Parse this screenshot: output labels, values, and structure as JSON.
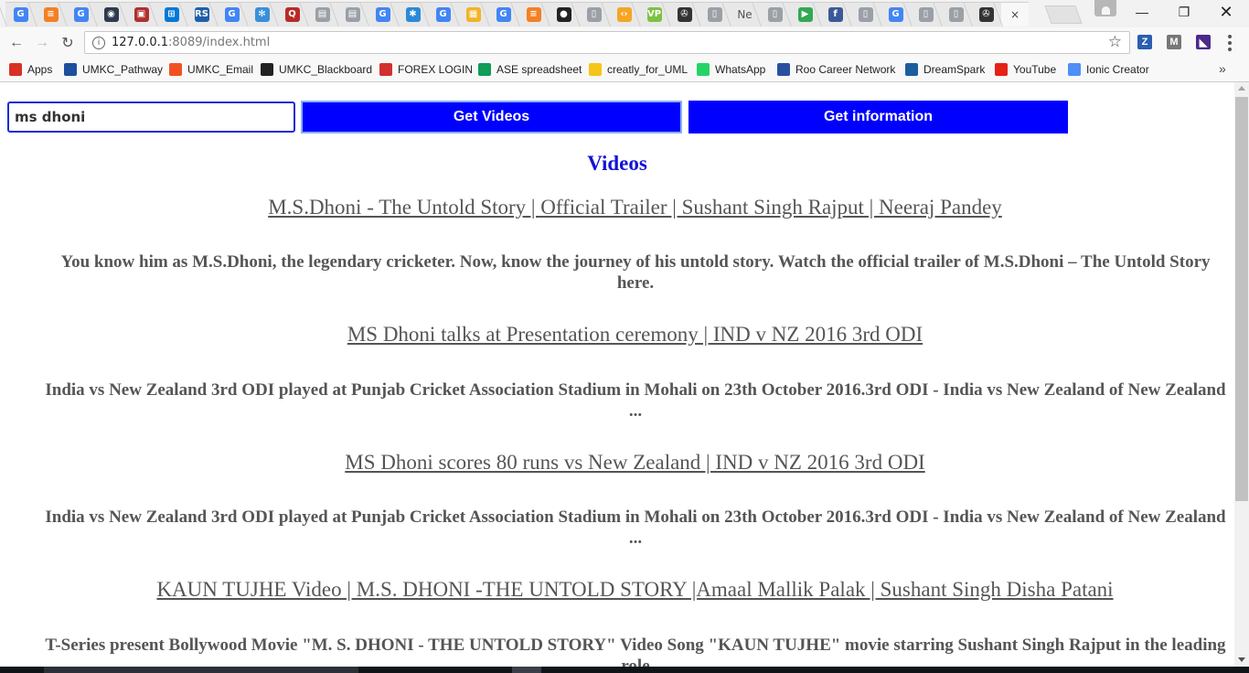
{
  "browser": {
    "tabs": [
      {
        "icon": "google-icon",
        "glyph": "G",
        "color": "#4285f4"
      },
      {
        "icon": "stackoverflow-icon",
        "glyph": "≡",
        "color": "#f48024"
      },
      {
        "icon": "google-icon",
        "glyph": "G",
        "color": "#4285f4"
      },
      {
        "icon": "camera-icon",
        "glyph": "◉",
        "color": "#2d3b4e"
      },
      {
        "icon": "media-icon",
        "glyph": "▣",
        "color": "#b03030"
      },
      {
        "icon": "windows-icon",
        "glyph": "⊞",
        "color": "#0078d7"
      },
      {
        "icon": "rs-icon",
        "glyph": "RS",
        "color": "#1f5fa8"
      },
      {
        "icon": "google-icon",
        "glyph": "G",
        "color": "#4285f4"
      },
      {
        "icon": "snowflake-icon",
        "glyph": "✻",
        "color": "#3a8fd8"
      },
      {
        "icon": "quora-icon",
        "glyph": "Q",
        "color": "#b92b27"
      },
      {
        "icon": "doc-icon",
        "glyph": "▤",
        "color": "#9aa0a6"
      },
      {
        "icon": "doc-icon",
        "glyph": "▤",
        "color": "#9aa0a6"
      },
      {
        "icon": "google-icon",
        "glyph": "G",
        "color": "#4285f4"
      },
      {
        "icon": "asterisk-icon",
        "glyph": "✱",
        "color": "#2a8ad8"
      },
      {
        "icon": "google-icon",
        "glyph": "G",
        "color": "#4285f4"
      },
      {
        "icon": "box-icon",
        "glyph": "▦",
        "color": "#f0b429"
      },
      {
        "icon": "google-icon",
        "glyph": "G",
        "color": "#4285f4"
      },
      {
        "icon": "stackoverflow-icon",
        "glyph": "≡",
        "color": "#f48024"
      },
      {
        "icon": "github-icon",
        "glyph": "●",
        "color": "#222222"
      },
      {
        "icon": "page-icon",
        "glyph": "▯",
        "color": "#9aa0a6"
      },
      {
        "icon": "code-icon",
        "glyph": "‹›",
        "color": "#f5a623"
      },
      {
        "icon": "vp-icon",
        "glyph": "VP",
        "color": "#7dc242"
      },
      {
        "icon": "film-icon",
        "glyph": "✇",
        "color": "#333333"
      },
      {
        "icon": "page-icon",
        "glyph": "▯",
        "color": "#9aa0a6"
      },
      {
        "icon": "ne-tab-text",
        "glyph": "Ne",
        "color": "#555555",
        "text": true
      },
      {
        "icon": "page-icon",
        "glyph": "▯",
        "color": "#9aa0a6"
      },
      {
        "icon": "play-store-icon",
        "glyph": "▶",
        "color": "#34a853"
      },
      {
        "icon": "facebook-icon",
        "glyph": "f",
        "color": "#3b5998"
      },
      {
        "icon": "page-icon",
        "glyph": "▯",
        "color": "#9aa0a6"
      },
      {
        "icon": "google-icon",
        "glyph": "G",
        "color": "#4285f4"
      },
      {
        "icon": "page-icon",
        "glyph": "▯",
        "color": "#9aa0a6"
      },
      {
        "icon": "page-icon",
        "glyph": "▯",
        "color": "#9aa0a6"
      },
      {
        "icon": "film-icon",
        "glyph": "✇",
        "color": "#333333"
      },
      {
        "icon": "close-icon",
        "glyph": "×",
        "color": "#444444",
        "text": true,
        "active": true
      }
    ],
    "url_host": "127.0.0.1",
    "url_rest": ":8089/index.html",
    "extensions": [
      {
        "icon": "zotero-icon",
        "glyph": "Z",
        "color": "#2b5eb0"
      },
      {
        "icon": "m-extension-icon",
        "glyph": "M",
        "color": "#777777"
      },
      {
        "icon": "purple-extension-icon",
        "glyph": "◣",
        "color": "#4b2a8a"
      }
    ]
  },
  "bookmarks": [
    {
      "label": "Apps",
      "icon": "apps-grid-icon",
      "color": "#d93025"
    },
    {
      "label": "UMKC_Pathway",
      "icon": "umkc-icon",
      "color": "#1d4f9c"
    },
    {
      "label": "UMKC_Email",
      "icon": "windows-icon",
      "color": "#f25022"
    },
    {
      "label": "UMKC_Blackboard",
      "icon": "blackboard-icon",
      "color": "#222222"
    },
    {
      "label": "FOREX LOGIN",
      "icon": "forex-icon",
      "color": "#d32f2f"
    },
    {
      "label": "ASE spreadsheet",
      "icon": "sheets-icon",
      "color": "#0f9d58"
    },
    {
      "label": "creatly_for_UML",
      "icon": "sun-icon",
      "color": "#f5c518"
    },
    {
      "label": "WhatsApp",
      "icon": "whatsapp-icon",
      "color": "#25d366"
    },
    {
      "label": "Roo Career Network",
      "icon": "career-icon",
      "color": "#2b4fa0"
    },
    {
      "label": "DreamSpark",
      "icon": "dreamspark-icon",
      "color": "#1b5e9e"
    },
    {
      "label": "YouTube",
      "icon": "youtube-icon",
      "color": "#e62117"
    },
    {
      "label": "Ionic Creator",
      "icon": "ionic-icon",
      "color": "#4e8ef7"
    }
  ],
  "page": {
    "search_value": "ms dhoni",
    "get_videos_label": "Get Videos",
    "get_information_label": "Get information",
    "videos_heading": "Videos",
    "videos": [
      {
        "title": "M.S.Dhoni - The Untold Story | Official Trailer | Sushant Singh Rajput | Neeraj Pandey",
        "description": "You know him as M.S.Dhoni, the legendary cricketer. Now, know the journey of his untold story. Watch the official trailer of M.S.Dhoni – The Untold Story here."
      },
      {
        "title": "MS Dhoni talks at Presentation ceremony | IND v NZ 2016 3rd ODI",
        "description": "India vs New Zealand 3rd ODI played at Punjab Cricket Association Stadium in Mohali on 23th October 2016.3rd ODI - India vs New Zealand of New Zealand ..."
      },
      {
        "title": "MS Dhoni scores 80 runs vs New Zealand | IND v NZ 2016 3rd ODI",
        "description": "India vs New Zealand 3rd ODI played at Punjab Cricket Association Stadium in Mohali on 23th October 2016.3rd ODI - India vs New Zealand of New Zealand ..."
      },
      {
        "title": "KAUN TUJHE Video | M.S. DHONI -THE UNTOLD STORY |Amaal Mallik Palak | Sushant Singh Disha Patani",
        "description": "T-Series present Bollywood Movie \"M. S. DHONI - THE UNTOLD STORY\" Video Song \"KAUN TUJHE\" movie starring Sushant Singh Rajput in the leading role"
      }
    ]
  },
  "colors": {
    "button_blue": "#0000ff",
    "heading_blue": "#1212d6",
    "text_gray": "#555555"
  }
}
